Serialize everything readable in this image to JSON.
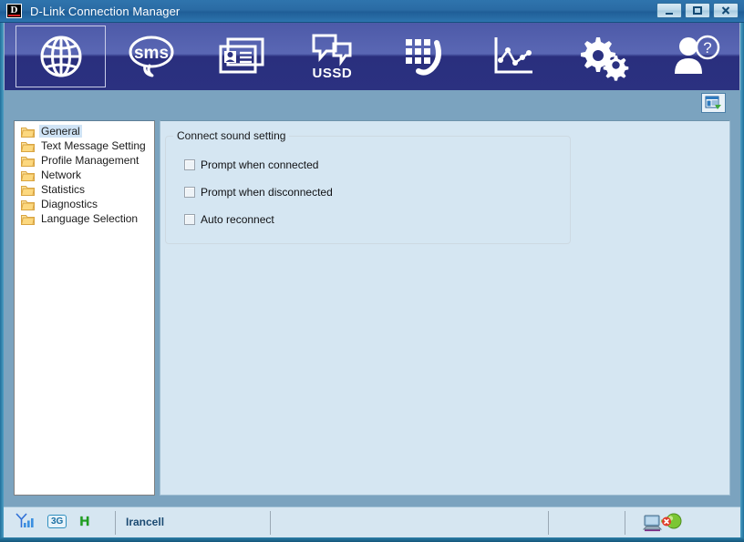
{
  "window": {
    "title": "D-Link Connection Manager",
    "logo_letter": "D",
    "logo_name": "dlink-logo",
    "buttons": {
      "minimize": "minimize",
      "maximize": "maximize",
      "close": "close"
    }
  },
  "toolbar": {
    "items": [
      {
        "id": "connection",
        "icon": "globe-icon",
        "label": "",
        "selected": true
      },
      {
        "id": "sms",
        "icon": "sms-icon",
        "label": "",
        "selected": false
      },
      {
        "id": "phonebook",
        "icon": "contacts-icon",
        "label": "",
        "selected": false
      },
      {
        "id": "ussd",
        "icon": "ussd-icon",
        "label": "USSD",
        "selected": false
      },
      {
        "id": "dialer",
        "icon": "keypad-phone-icon",
        "label": "",
        "selected": false
      },
      {
        "id": "statistics",
        "icon": "chart-icon",
        "label": "",
        "selected": false
      },
      {
        "id": "settings",
        "icon": "gears-icon",
        "label": "",
        "selected": false
      },
      {
        "id": "help",
        "icon": "person-help-icon",
        "label": "",
        "selected": false
      }
    ],
    "doc_button_icon": "document-export-icon"
  },
  "tree": {
    "items": [
      {
        "label": "General",
        "selected": true
      },
      {
        "label": "Text Message Setting",
        "selected": false
      },
      {
        "label": "Profile Management",
        "selected": false
      },
      {
        "label": "Network",
        "selected": false
      },
      {
        "label": "Statistics",
        "selected": false
      },
      {
        "label": "Diagnostics",
        "selected": false
      },
      {
        "label": "Language Selection",
        "selected": false
      }
    ]
  },
  "content": {
    "group_title": "Connect sound setting",
    "checkboxes": [
      {
        "label": "Prompt when connected",
        "checked": false
      },
      {
        "label": "Prompt when disconnected",
        "checked": false
      },
      {
        "label": "Auto reconnect",
        "checked": false
      }
    ]
  },
  "status_bar": {
    "signal_icon": "signal-bars-icon",
    "network_badge": "3G",
    "hsdpa_badge": "H",
    "carrier": "Irancell",
    "connection_icon": "computer-disconnected-globe-icon"
  },
  "colors": {
    "title_bar": "#2a6ba4",
    "toolbar_top": "#5a67b4",
    "toolbar_bottom": "#2b3180",
    "window_bg": "#7ba3bf",
    "content_bg": "#d5e6f2",
    "status_bg": "#d6e6f1",
    "selection": "#cfe3f5",
    "folder": "#f0c14b",
    "carrier_text": "#1b4a72"
  }
}
